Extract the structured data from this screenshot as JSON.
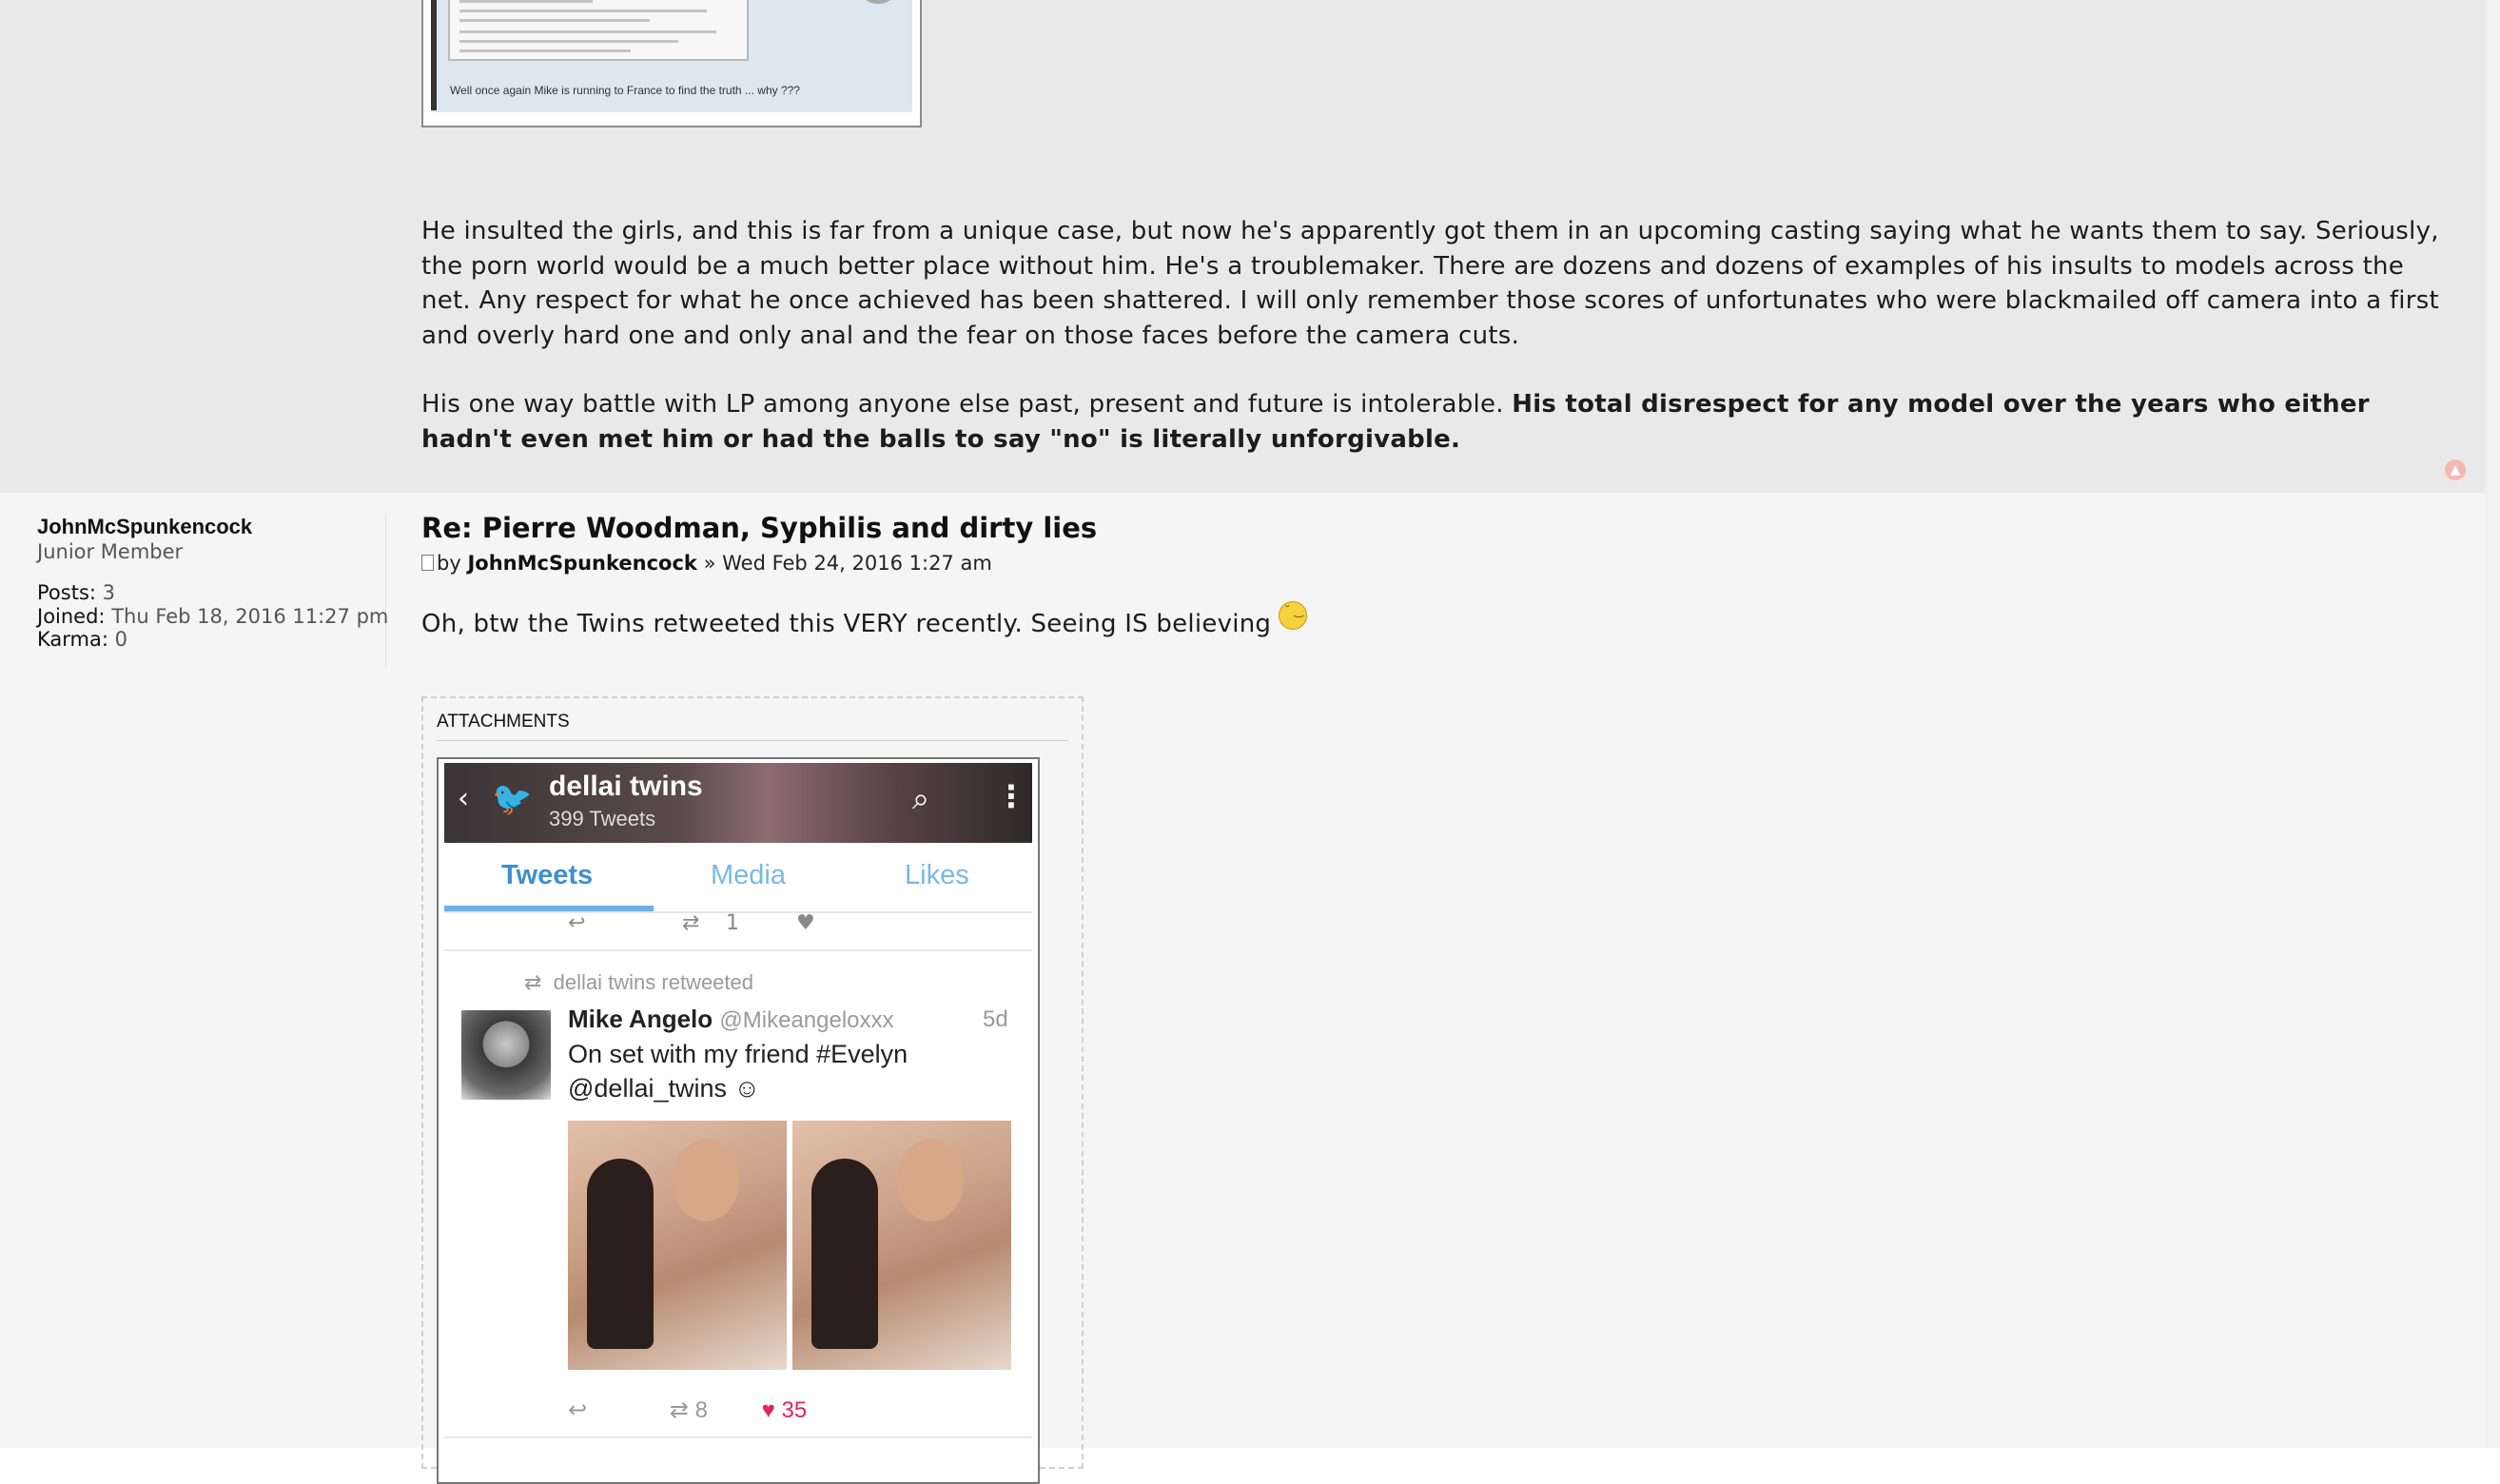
{
  "previous_post": {
    "attachment_caption": "Well once again Mike is running to France to find the truth ... why ???",
    "paragraph1": "He insulted the girls, and this is far from a unique case, but now he's apparently got them in an upcoming casting saying what he wants them to say. Seriously, the porn world would be a much better place without him. He's a troublemaker. There are dozens and dozens of examples of his insults to models across the net. Any respect for what he once achieved has been shattered. I will only remember those scores of unfortunates who were blackmailed off camera into a first and overly hard one and only anal and the fear on those faces before the camera cuts.",
    "paragraph2_plain": "His one way battle with LP among anyone else past, present and future is intolerable. ",
    "paragraph2_bold": "His total disrespect for any model over the years who either hadn't even met him or had the balls to say \"no\" is literally unforgivable.",
    "top_icon": "back-to-top-icon"
  },
  "profile": {
    "username": "JohnMcSpunkencock",
    "rank": "Junior Member",
    "posts_label": "Posts:",
    "posts_value": "3",
    "joined_label": "Joined:",
    "joined_value": "Thu Feb 18, 2016 11:27 pm",
    "karma_label": "Karma:",
    "karma_value": "0"
  },
  "post": {
    "title": "Re: Pierre Woodman, Syphilis and dirty lies",
    "by": "by",
    "author": "JohnMcSpunkencock",
    "sep": "»",
    "date": "Wed Feb 24, 2016 1:27 am",
    "body": "Oh, btw the Twins retweeted this VERY recently. Seeing IS believing",
    "attachments_heading": "ATTACHMENTS"
  },
  "tweet_screenshot": {
    "account_name": "dellai twins",
    "tweet_count": "399 Tweets",
    "tabs": [
      "Tweets",
      "Media",
      "Likes"
    ],
    "prev_retweets": "1",
    "retweeted_label": "dellai twins retweeted",
    "user_name": "Mike Angelo",
    "user_handle": "@Mikeangeloxxx",
    "time": "5d",
    "text": "On set with my friend #Evelyn @dellai_twins",
    "retweets": "8",
    "likes": "35"
  }
}
